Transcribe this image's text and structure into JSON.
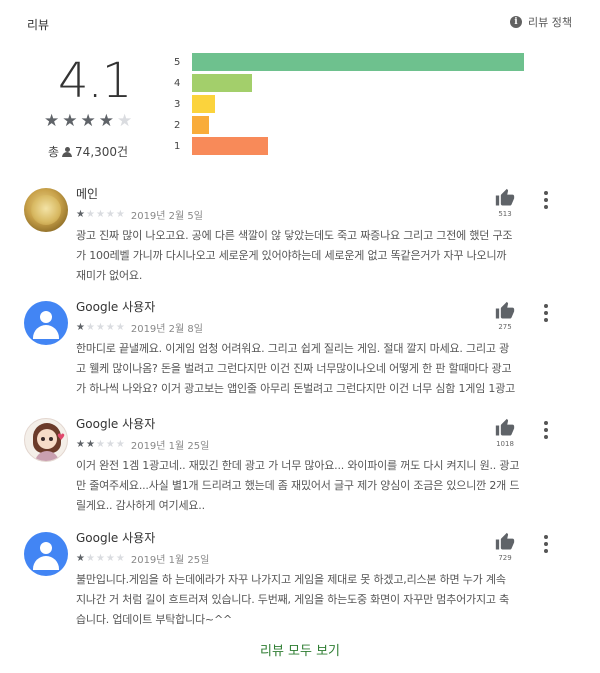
{
  "header": {
    "title": "리뷰",
    "policy_label": "리뷰 정책"
  },
  "summary": {
    "average": "4.1",
    "stars": 4,
    "total_prefix": "총",
    "total_count": "74,300건"
  },
  "rating_bars": [
    {
      "label": "5",
      "fraction": 1.0,
      "color": "#6ec18e"
    },
    {
      "label": "4",
      "fraction": 0.18,
      "color": "#a3cf6b"
    },
    {
      "label": "3",
      "fraction": 0.07,
      "color": "#fbd33c"
    },
    {
      "label": "2",
      "fraction": 0.05,
      "color": "#f9ac3a"
    },
    {
      "label": "1",
      "fraction": 0.23,
      "color": "#f88a59"
    }
  ],
  "reviews": [
    {
      "author": "메인",
      "rating": 1,
      "date": "2019년 2월 5일",
      "likes": "513",
      "avatar": "gold",
      "lines": [
        "광고 진짜 많이 나오고요. 공에 다른 색깔이 않 닿았는데도 죽고 짜증나요 그리고 그전에 했던 구조",
        "가 100레벨 가니까 다시나오고 세로운게 있어야하는데 세로운게 없고 똑같은거가 자꾸 나오니까",
        "재미가 없어요."
      ]
    },
    {
      "author": "Google 사용자",
      "rating": 1,
      "date": "2019년 2월 8일",
      "likes": "275",
      "avatar": "blue",
      "lines": [
        "한마디로 끝낼께요. 이게임 엄청 어려워요. 그리고 쉽게 질리는 게임. 절대 깔지 마세요. 그리고 광",
        "고 웰케 많이나옴? 돈을 벌려고 그런다지만 이건 진짜 너무많이나오네 어떻게 한 판 할때마다 광고",
        "가 하나씩 나와요? 이거 광고보는 앱인줄 아무리 돈벌려고 그런다지만 이건 너무 심함 1게임 1광고"
      ]
    },
    {
      "author": "Google 사용자",
      "rating": 2,
      "date": "2019년 1월 25일",
      "likes": "1018",
      "avatar": "girl",
      "lines": [
        "이거 완전 1겜 1광고네.. 재밌긴 한데 광고 가 너무 많아요... 와이파이를 꺼도 다시 켜지니 원.. 광고",
        "만 줄여주세요...사실 별1개 드리려고 했는데 좀 재밌어서 글구 제가 양심이 조금은 있으니깐 2개 드",
        "릴게요.. 감사하게 여기세요.."
      ]
    },
    {
      "author": "Google 사용자",
      "rating": 1,
      "date": "2019년 1월 25일",
      "likes": "729",
      "avatar": "blue",
      "lines": [
        "불만입니다.게임을 하 는데에라가 자꾸 나가지고 게임을 제대로 못 하겠고,리스본 하면 누가 계속",
        "지나간 거 처럼 길이 흐트러져 있습니다. 두번째, 게임을 하는도중 화면이 자꾸만 멈추어가지고 축",
        "습니다. 업데이트 부탁합니다~^^"
      ]
    }
  ],
  "footer": {
    "all_reviews_label": "리뷰 모두 보기"
  },
  "colors": {
    "star_on": "#5f6368",
    "star_off": "#dadce0",
    "link": "#2e7d32"
  }
}
